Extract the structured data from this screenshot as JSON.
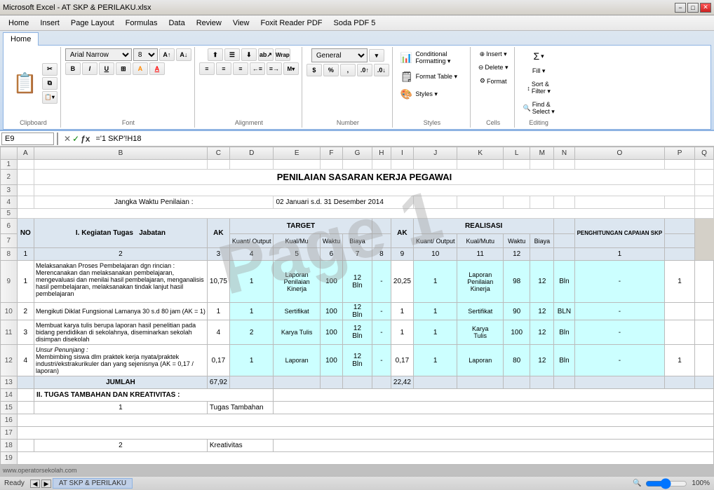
{
  "titlebar": {
    "text": "Microsoft Excel - AT SKP & PERILAKU.xlsx",
    "min": "−",
    "max": "□",
    "close": "✕"
  },
  "menubar": {
    "items": [
      "Home",
      "Insert",
      "Page Layout",
      "Formulas",
      "Data",
      "Review",
      "View",
      "Foxit Reader PDF",
      "Soda PDF 5"
    ]
  },
  "ribbon": {
    "tabs": [
      "Home",
      "Insert",
      "Page Layout",
      "Formulas",
      "Data",
      "Review",
      "View",
      "Foxit Reader PDF",
      "Soda PDF 5"
    ],
    "active_tab": "Home",
    "clipboard_label": "Clipboard",
    "font_label": "Font",
    "alignment_label": "Alignment",
    "number_label": "Number",
    "styles_label": "Styles",
    "cells_label": "Cells",
    "editing_label": "Editing",
    "font_name": "Arial Narrow",
    "font_size": "8",
    "number_format": "General",
    "format_table": "Format Table ▾",
    "cell_styles": "Styles ▾",
    "format_btn": "Format",
    "narrow_label": "Narrow"
  },
  "formulabar": {
    "cell_ref": "E9",
    "formula": "='1 SKP'!H18"
  },
  "sheet": {
    "title_row3": "PENILAIAN SASARAN KERJA PEGAWAI",
    "period_label": "Jangka Waktu Penilaian :",
    "period_value": "02 Januari s.d. 31 Desember 2014",
    "headers_row6": [
      "NO",
      "I. Kegiatan Tugas  Jabatan",
      "AK",
      "",
      "TARGET",
      "",
      "",
      "",
      "AK",
      "",
      "REALISASI",
      "",
      "",
      "",
      "PENGHITUNGAN CAPAIAN SKP"
    ],
    "target_sub": [
      "Kuant/ Output",
      "Kual/Mu",
      "Waktu",
      "Biaya"
    ],
    "realisasi_sub": [
      "Kuant/ Output",
      "Kual/Mutu",
      "Waktu",
      "Biaya"
    ],
    "row8": [
      "1",
      "2",
      "3",
      "4",
      "5",
      "6",
      "7",
      "8",
      "9",
      "10",
      "11",
      "12"
    ],
    "rows": [
      {
        "no": "1",
        "kegiatan": "Melaksanakan Proses Pembelajaran dgn rincian : Merencanakan dan melaksanakan pembelajaran, mengevaluasi dan menilai hasil pembelajaran, menganalisis hasil pembelajaran, melaksanakan tindak lanjut hasil pembelajaran",
        "ak": "10,75",
        "kuant_out_t": "1",
        "kuant_label_t": "Laporan Penilaian Kinerja",
        "kual_t": "100",
        "waktu_t": "12",
        "satuan_t": "Bln",
        "biaya_t": "-",
        "ak_r": "20,25",
        "kuant_out_r": "1",
        "kuant_label_r": "Laporan Penilaian Kinerja",
        "kual_r": "98",
        "waktu_r": "12",
        "satuan_r": "Bln",
        "biaya_r": "-",
        "penghitungan": "1"
      },
      {
        "no": "2",
        "kegiatan": "Mengikuti Diklat Fungsional Lamanya 30 s.d 80 jam (AK = 1)",
        "ak": "1",
        "kuant_out_t": "1",
        "kuant_label_t": "Sertifikat",
        "kual_t": "100",
        "waktu_t": "12",
        "satuan_t": "Bln",
        "biaya_t": "-",
        "ak_r": "1",
        "kuant_out_r": "1",
        "kuant_label_r": "Sertifikat",
        "kual_r": "90",
        "waktu_r": "12",
        "satuan_r": "BLN",
        "biaya_r": "-",
        "penghitungan": ""
      },
      {
        "no": "3",
        "kegiatan": "Membuat karya tulis berupa laporan hasil penelitian pada bidang pendidikan di sekolahnya, diseminarkan sekolah disimpan disekolah",
        "ak": "4",
        "kuant_out_t": "2",
        "kuant_label_t": "Karya Tulis",
        "kual_t": "100",
        "waktu_t": "12",
        "satuan_t": "Bln",
        "biaya_t": "-",
        "ak_r": "1",
        "kuant_out_r": "1",
        "kuant_label_r": "Karya Tulis",
        "kual_r": "100",
        "waktu_r": "12",
        "satuan_r": "Bln",
        "biaya_r": "-",
        "penghitungan": ""
      },
      {
        "no": "4",
        "kegiatan_header": "Unsur Penunjang :",
        "kegiatan": "Membimbing siswa dlm praktek kerja nyata/praktek industri/ekstrakurikuler dan yang sejenisnya (AK = 0,17 / laporan)",
        "ak": "0,17",
        "kuant_out_t": "1",
        "kuant_label_t": "Laporan",
        "kual_t": "100",
        "waktu_t": "12",
        "satuan_t": "Bln",
        "biaya_t": "-",
        "ak_r": "0,17",
        "kuant_out_r": "1",
        "kuant_label_r": "Laporan",
        "kual_r": "80",
        "waktu_r": "12",
        "satuan_r": "Bln",
        "biaya_r": "-",
        "penghitungan": "1"
      }
    ],
    "jumlah_label": "JUMLAH",
    "jumlah_ak_t": "67,92",
    "jumlah_ak_r": "22,42",
    "section2_label": "II. TUGAS TAMBAHAN DAN KREATIVITAS :",
    "tugas_tambahan_no": "1",
    "tugas_tambahan_label": "Tugas Tambahan",
    "kreativitas_no": "2",
    "kreativitas_label": "Kreativitas",
    "watermark": "Page 1"
  },
  "statusbar": {
    "ready": "Ready",
    "sheet_tabs": [
      "AT SKP & PERILAKU"
    ],
    "zoom": "100%"
  },
  "url": "www.operatorsekolah.com"
}
